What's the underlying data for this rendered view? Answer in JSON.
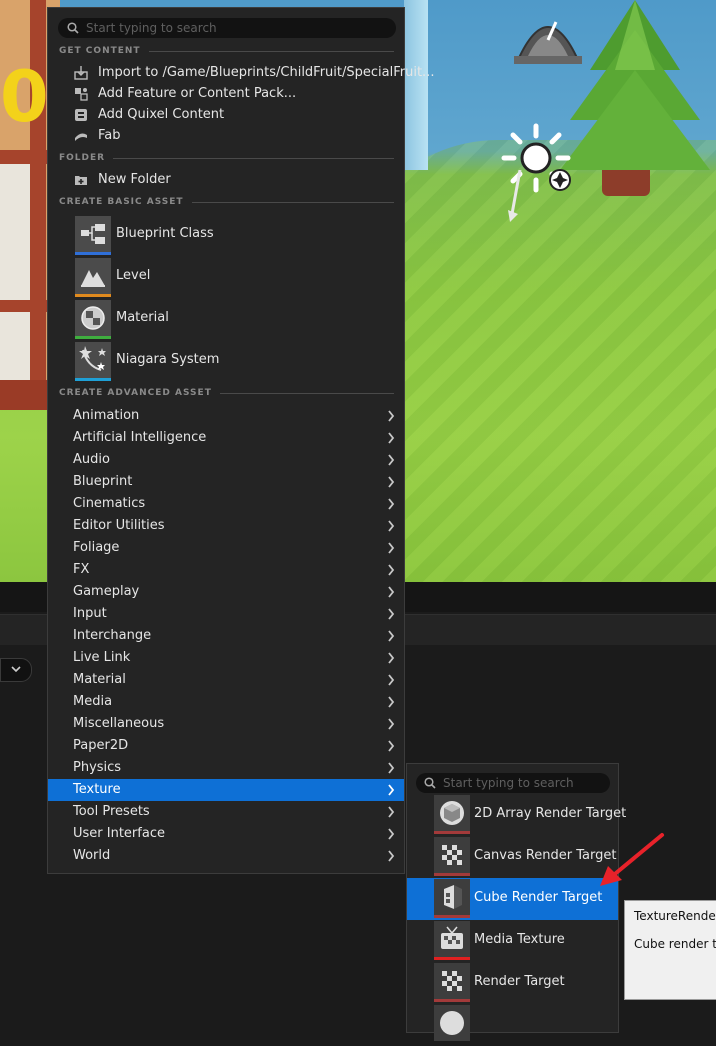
{
  "viewport": {
    "score_value": "0"
  },
  "menu": {
    "search_placeholder": "Start typing to search",
    "sections": {
      "get_content": "GET CONTENT",
      "folder": "FOLDER",
      "create_basic": "CREATE BASIC ASSET",
      "create_advanced": "CREATE ADVANCED ASSET"
    },
    "get_content_items": [
      {
        "label": "Import to /Game/Blueprints/ChildFruit/SpecialFruit...",
        "icon": "import-icon"
      },
      {
        "label": "Add Feature or Content Pack...",
        "icon": "feature-pack-icon"
      },
      {
        "label": "Add Quixel Content",
        "icon": "quixel-icon"
      },
      {
        "label": "Fab",
        "icon": "fab-icon"
      }
    ],
    "folder_items": [
      {
        "label": "New Folder",
        "icon": "new-folder-icon"
      }
    ],
    "basic_assets": [
      {
        "label": "Blueprint Class",
        "icon": "blueprint-class-icon",
        "color": "#2f6fd8"
      },
      {
        "label": "Level",
        "icon": "level-icon",
        "color": "#e08a1e"
      },
      {
        "label": "Material",
        "icon": "material-icon",
        "color": "#3fae3f"
      },
      {
        "label": "Niagara System",
        "icon": "niagara-system-icon",
        "color": "#1fa0d6"
      }
    ],
    "advanced_assets": [
      "Animation",
      "Artificial Intelligence",
      "Audio",
      "Blueprint",
      "Cinematics",
      "Editor Utilities",
      "Foliage",
      "FX",
      "Gameplay",
      "Input",
      "Interchange",
      "Live Link",
      "Material",
      "Media",
      "Miscellaneous",
      "Paper2D",
      "Physics",
      "Texture",
      "Tool Presets",
      "User Interface",
      "World"
    ],
    "active_advanced": "Texture"
  },
  "submenu": {
    "search_placeholder": "Start typing to search",
    "items": [
      {
        "label": "2D Array Render Target",
        "icon": "2d-array-render-target-icon"
      },
      {
        "label": "Canvas Render Target",
        "icon": "canvas-render-target-icon"
      },
      {
        "label": "Cube Render Target",
        "icon": "cube-render-target-icon"
      },
      {
        "label": "Media Texture",
        "icon": "media-texture-icon"
      },
      {
        "label": "Render Target",
        "icon": "render-target-icon"
      }
    ],
    "active": "Cube Render Target"
  },
  "tooltip": {
    "title": "TextureRenderT",
    "description": "Cube render tar for rendering as"
  },
  "colors": {
    "accent": "#0e70d6",
    "menu_bg": "#242424",
    "annotation": "#e8222a"
  }
}
